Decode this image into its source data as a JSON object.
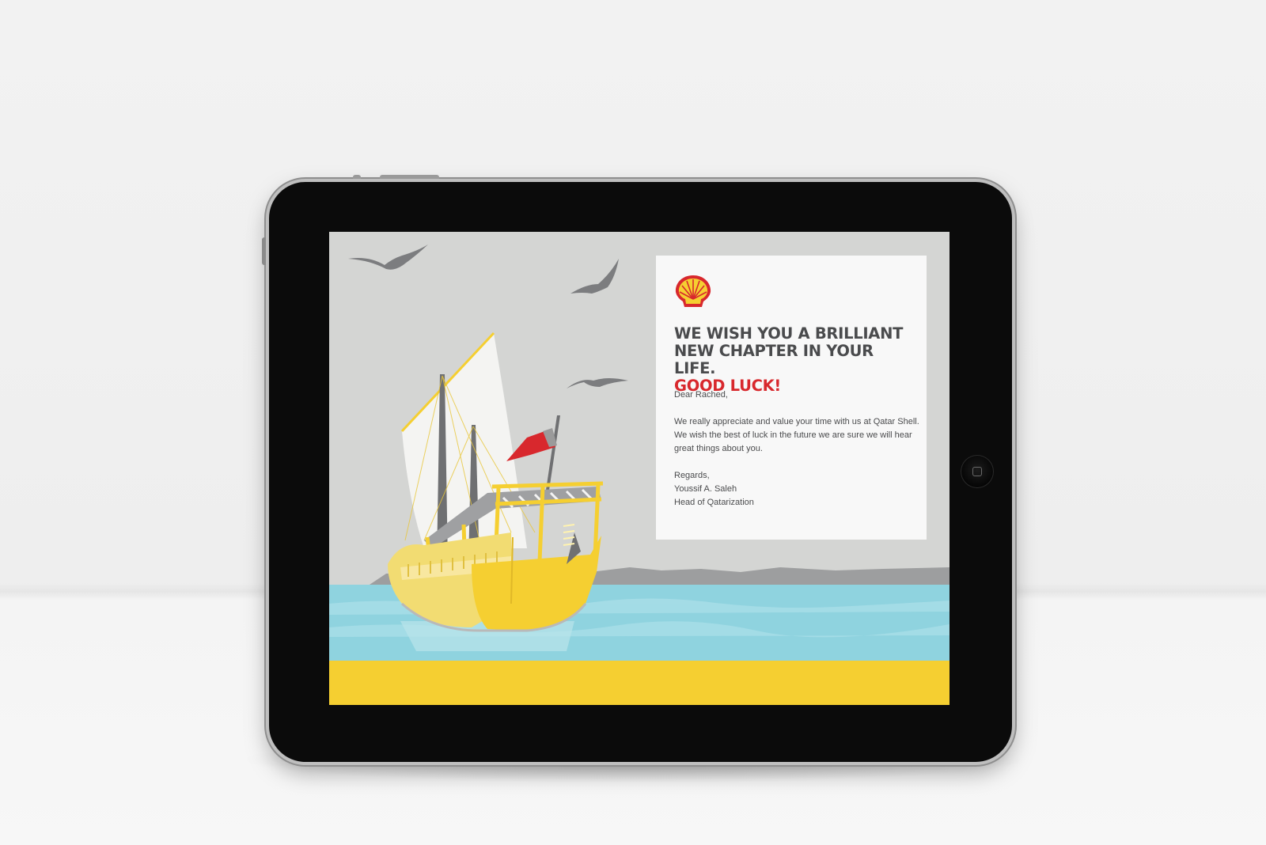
{
  "colors": {
    "brand_red": "#d8282d",
    "brand_yellow": "#f5cf31",
    "sea": "#8fd3df",
    "sky": "#d4d5d3",
    "text": "#4a4b4d"
  },
  "device": {
    "type": "tablet",
    "home_button_icon": "home-button-icon"
  },
  "card": {
    "logo": "shell-logo-icon",
    "headline_line1": "WE WISH YOU A BRILLIANT",
    "headline_line2": "NEW CHAPTER IN YOUR LIFE.",
    "headline_accent": "GOOD LUCK!",
    "greeting": "Dear Rached,",
    "message": "We really appreciate and value your time with us at Qatar Shell. We wish the best of luck in the future we are sure we will hear great things about you.",
    "closing": "Regards,",
    "signatory_name": "Youssif A. Saleh",
    "signatory_title": "Head of Qatarization"
  },
  "illustration": {
    "elements": [
      "seagull-icon",
      "seagull-icon",
      "seagull-icon",
      "dhow-boat-illustration",
      "flag-icon",
      "sea",
      "distant-hills"
    ]
  }
}
